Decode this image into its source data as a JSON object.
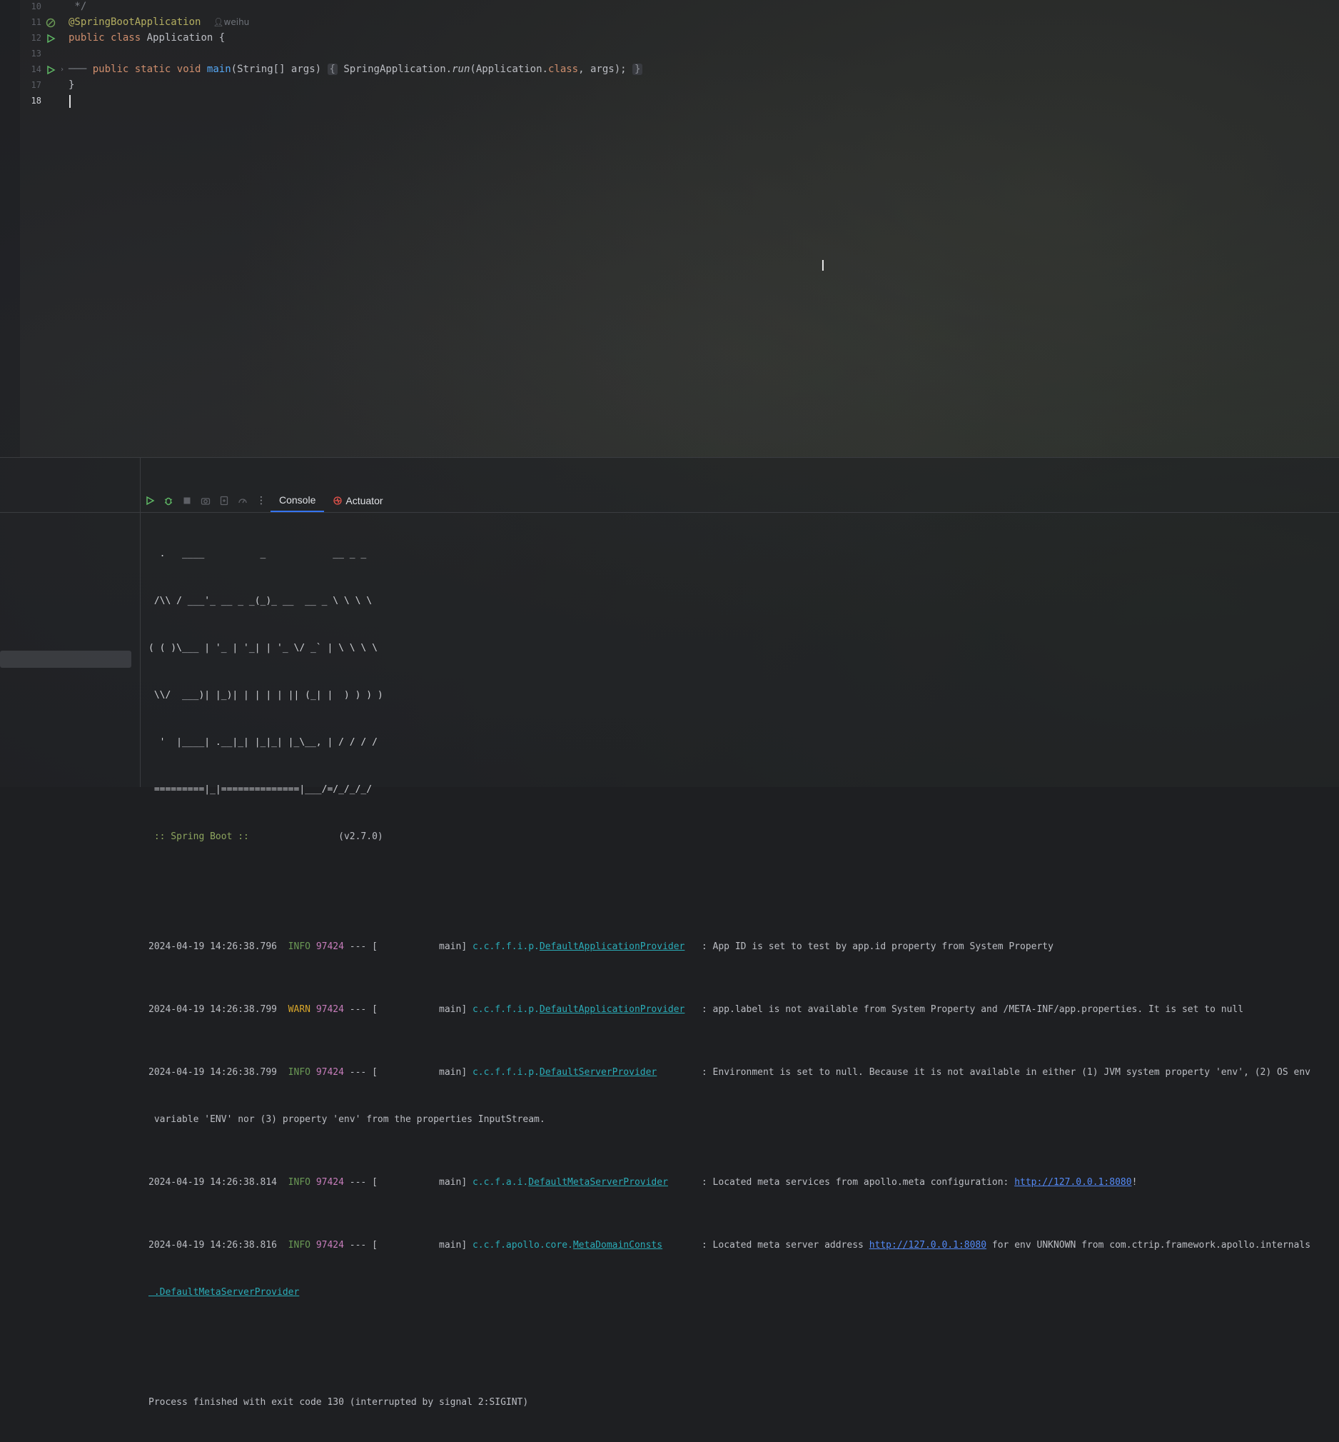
{
  "editor": {
    "lines": [
      {
        "num": "10",
        "text": " */"
      },
      {
        "num": "11",
        "annotation": "@SpringBootApplication",
        "author": "weihu"
      },
      {
        "num": "12",
        "kw1": "public",
        "kw2": "class",
        "rest": " Application {"
      },
      {
        "num": "13"
      },
      {
        "num": "14",
        "indent": "───",
        "kw1": "public",
        "kw2": "static",
        "kw3": "void",
        "fn": "main",
        "params": "(String[] args) ",
        "body_open": "{",
        "body_pre": " SpringApplication.",
        "body_run": "run",
        "body_mid": "(Application.",
        "body_class": "class",
        "body_end": ", args); ",
        "body_close": "}"
      },
      {
        "num": "17",
        "text": "}"
      },
      {
        "num": "18"
      }
    ]
  },
  "run_window": {
    "tabs": [
      {
        "label": "Console"
      },
      {
        "label": "Actuator"
      }
    ],
    "banner": [
      "  .   ____          _            __ _ _",
      " /\\\\ / ___'_ __ _ _(_)_ __  __ _ \\ \\ \\ \\",
      "( ( )\\___ | '_ | '_| | '_ \\/ _` | \\ \\ \\ \\",
      " \\\\/  ___)| |_)| | | | | || (_| |  ) ) ) )",
      "  '  |____| .__|_| |_|_| |_\\__, | / / / /",
      " =========|_|==============|___/=/_/_/_/"
    ],
    "boot_label": " :: Spring Boot ::",
    "boot_version": "                (v2.7.0)",
    "logs": [
      {
        "ts": "2024-04-19 14:26:38.796",
        "level": "INFO",
        "pid": "97424",
        "thread": " --- [           main] ",
        "logger_prefix": "c.c.f.f.i.p.",
        "logger_class": "DefaultApplicationProvider",
        "pad": "   ",
        "msg": ": App ID is set to test by app.id property from System Property"
      },
      {
        "ts": "2024-04-19 14:26:38.799",
        "level": "WARN",
        "pid": "97424",
        "thread": " --- [           main] ",
        "logger_prefix": "c.c.f.f.i.p.",
        "logger_class": "DefaultApplicationProvider",
        "pad": "   ",
        "msg": ": app.label is not available from System Property and /META-INF/app.properties. It is set to null"
      },
      {
        "ts": "2024-04-19 14:26:38.799",
        "level": "INFO",
        "pid": "97424",
        "thread": " --- [           main] ",
        "logger_prefix": "c.c.f.f.i.p.",
        "logger_class": "DefaultServerProvider",
        "pad": "        ",
        "msg": ": Environment is set to null. Because it is not available in either (1) JVM system property 'env', (2) OS env",
        "cont": " variable 'ENV' nor (3) property 'env' from the properties InputStream."
      },
      {
        "ts": "2024-04-19 14:26:38.814",
        "level": "INFO",
        "pid": "97424",
        "thread": " --- [           main] ",
        "logger_prefix": "c.c.f.a.i.",
        "logger_class": "DefaultMetaServerProvider",
        "pad": "      ",
        "msg": ": Located meta services from apollo.meta configuration: ",
        "link": "http://127.0.0.1:8080",
        "msg_after": "!"
      },
      {
        "ts": "2024-04-19 14:26:38.816",
        "level": "INFO",
        "pid": "97424",
        "thread": " --- [           main] ",
        "logger_prefix": "c.c.f.apollo.core.",
        "logger_class": "MetaDomainConsts",
        "pad": "       ",
        "msg": ": Located meta server address ",
        "link": "http://127.0.0.1:8080",
        "msg_after": " for env UNKNOWN from com.ctrip.framework.apollo.internals",
        "cont": " .DefaultMetaServerProvider"
      }
    ],
    "exit_message": "Process finished with exit code 130 (interrupted by signal 2:SIGINT)"
  },
  "colors": {
    "accent": "#3574f0",
    "info": "#6a9955",
    "warn": "#d6a52b",
    "pid": "#c77dbb",
    "logger": "#2aacb8",
    "link": "#548af7"
  }
}
